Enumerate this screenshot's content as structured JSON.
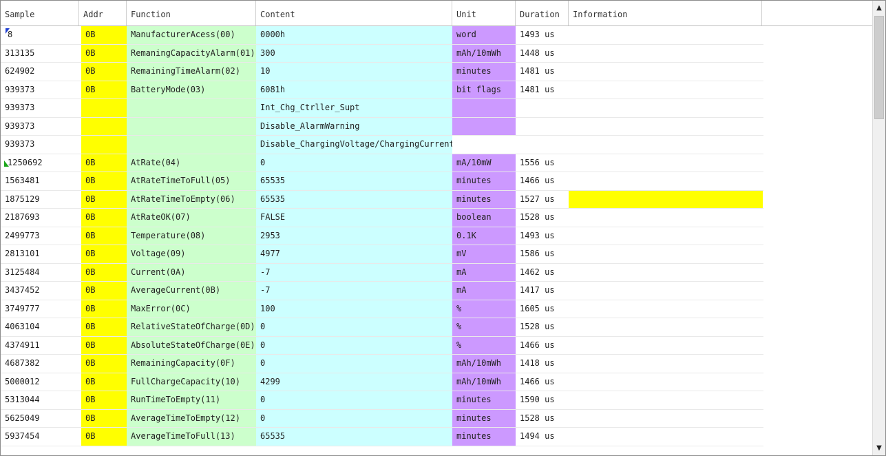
{
  "columns": {
    "sample": "Sample",
    "addr": "Addr",
    "function": "Function",
    "content": "Content",
    "unit": "Unit",
    "duration": "Duration",
    "information": "Information"
  },
  "rows": [
    {
      "sample": "8",
      "addr": "0B",
      "function": "ManufacturerAcess(00)",
      "content": "0000h",
      "unit": "word",
      "duration": "1493 us",
      "info": "",
      "marker": "blue"
    },
    {
      "sample": "313135",
      "addr": "0B",
      "function": "RemaningCapacityAlarm(01)",
      "content": "300",
      "unit": "mAh/10mWh",
      "duration": "1448 us",
      "info": ""
    },
    {
      "sample": "624902",
      "addr": "0B",
      "function": "RemainingTimeAlarm(02)",
      "content": "10",
      "unit": "minutes",
      "duration": "1481 us",
      "info": ""
    },
    {
      "sample": "939373",
      "addr": "0B",
      "function": "BatteryMode(03)",
      "content": "6081h",
      "unit": "bit flags",
      "duration": "1481 us",
      "info": ""
    },
    {
      "sample": "939373",
      "addr": "",
      "function": "",
      "content": "Int_Chg_Ctrller_Supt",
      "unit": "",
      "duration": "",
      "info": ""
    },
    {
      "sample": "939373",
      "addr": "",
      "function": "",
      "content": "Disable_AlarmWarning",
      "unit": "",
      "duration": "",
      "info": ""
    },
    {
      "sample": "939373",
      "addr": "",
      "function": "",
      "content": "Disable_ChargingVoltage/ChargingCurrent",
      "unit": "",
      "duration": "",
      "info": "",
      "noUnitFill": true
    },
    {
      "sample": "1250692",
      "addr": "0B",
      "function": "AtRate(04)",
      "content": "0",
      "unit": "mA/10mW",
      "duration": "1556 us",
      "info": "",
      "marker": "green"
    },
    {
      "sample": "1563481",
      "addr": "0B",
      "function": "AtRateTimeToFull(05)",
      "content": "65535",
      "unit": "minutes",
      "duration": "1466 us",
      "info": ""
    },
    {
      "sample": "1875129",
      "addr": "0B",
      "function": "AtRateTimeToEmpty(06)",
      "content": "65535",
      "unit": "minutes",
      "duration": "1527 us",
      "info": "",
      "infoYellow": true
    },
    {
      "sample": "2187693",
      "addr": "0B",
      "function": "AtRateOK(07)",
      "content": "FALSE",
      "unit": "boolean",
      "duration": "1528 us",
      "info": ""
    },
    {
      "sample": "2499773",
      "addr": "0B",
      "function": "Temperature(08)",
      "content": "2953",
      "unit": "0.1K",
      "duration": "1493 us",
      "info": ""
    },
    {
      "sample": "2813101",
      "addr": "0B",
      "function": "Voltage(09)",
      "content": "4977",
      "unit": "mV",
      "duration": "1586 us",
      "info": ""
    },
    {
      "sample": "3125484",
      "addr": "0B",
      "function": "Current(0A)",
      "content": "-7",
      "unit": "mA",
      "duration": "1462 us",
      "info": ""
    },
    {
      "sample": "3437452",
      "addr": "0B",
      "function": "AverageCurrent(0B)",
      "content": "-7",
      "unit": "mA",
      "duration": "1417 us",
      "info": ""
    },
    {
      "sample": "3749777",
      "addr": "0B",
      "function": "MaxError(0C)",
      "content": "100",
      "unit": "%",
      "duration": "1605 us",
      "info": ""
    },
    {
      "sample": "4063104",
      "addr": "0B",
      "function": "RelativeStateOfCharge(0D)",
      "content": "0",
      "unit": "%",
      "duration": "1528 us",
      "info": ""
    },
    {
      "sample": "4374911",
      "addr": "0B",
      "function": "AbsoluteStateOfCharge(0E)",
      "content": "0",
      "unit": "%",
      "duration": "1466 us",
      "info": ""
    },
    {
      "sample": "4687382",
      "addr": "0B",
      "function": "RemainingCapacity(0F)",
      "content": "0",
      "unit": "mAh/10mWh",
      "duration": "1418 us",
      "info": ""
    },
    {
      "sample": "5000012",
      "addr": "0B",
      "function": "FullChargeCapacity(10)",
      "content": "4299",
      "unit": "mAh/10mWh",
      "duration": "1466 us",
      "info": ""
    },
    {
      "sample": "5313044",
      "addr": "0B",
      "function": "RunTimeToEmpty(11)",
      "content": "0",
      "unit": "minutes",
      "duration": "1590 us",
      "info": ""
    },
    {
      "sample": "5625049",
      "addr": "0B",
      "function": "AverageTimeToEmpty(12)",
      "content": "0",
      "unit": "minutes",
      "duration": "1528 us",
      "info": ""
    },
    {
      "sample": "5937454",
      "addr": "0B",
      "function": "AverageTimeToFull(13)",
      "content": "65535",
      "unit": "minutes",
      "duration": "1494 us",
      "info": ""
    }
  ],
  "scrollbar": {
    "up_icon": "arrow-up-icon",
    "down_icon": "arrow-down-icon"
  }
}
